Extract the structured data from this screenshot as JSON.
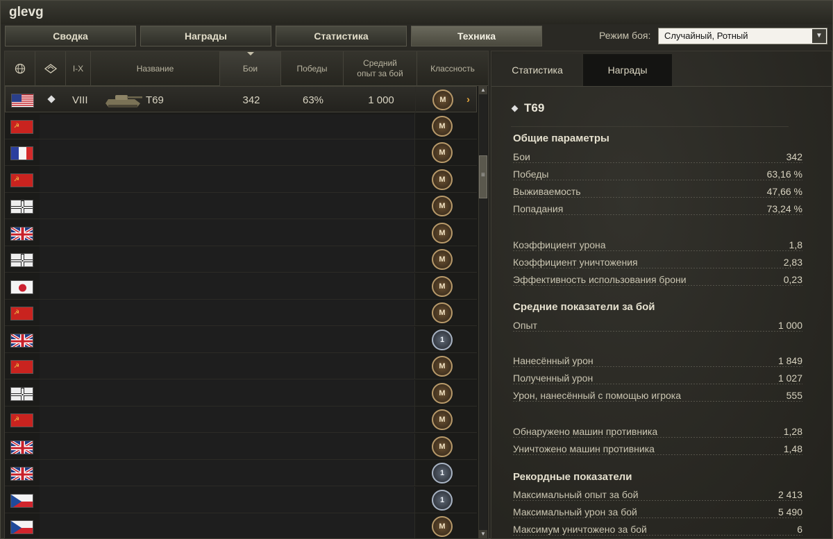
{
  "window": {
    "title": "glevg"
  },
  "tabs": [
    {
      "label": "Сводка",
      "active": false
    },
    {
      "label": "Награды",
      "active": false
    },
    {
      "label": "Статистика",
      "active": false
    },
    {
      "label": "Техника",
      "active": true
    }
  ],
  "battle_mode": {
    "label": "Режим боя:",
    "value": "Случайный, Ротный"
  },
  "table": {
    "headers": {
      "nation": "nation-globe-icon",
      "type": "vehicle-type-icon",
      "tier": "I-X",
      "name": "Название",
      "battles": "Бои",
      "wins": "Победы",
      "avg_xp": "Средний опыт за бой",
      "mastery": "Классность"
    },
    "sorted_column": "battles",
    "selected_row": {
      "nation": "usa",
      "tier": "VIII",
      "name": "T69",
      "battles": "342",
      "wins": "63%",
      "avg_xp": "1 000",
      "mastery": "M"
    },
    "rows": [
      {
        "nation": "usa",
        "mastery": "M"
      },
      {
        "nation": "ussr",
        "mastery": "M"
      },
      {
        "nation": "france",
        "mastery": "M"
      },
      {
        "nation": "ussr",
        "mastery": "M"
      },
      {
        "nation": "germany",
        "mastery": "M"
      },
      {
        "nation": "uk",
        "mastery": "M"
      },
      {
        "nation": "germany",
        "mastery": "M"
      },
      {
        "nation": "japan",
        "mastery": "M"
      },
      {
        "nation": "ussr",
        "mastery": "M"
      },
      {
        "nation": "uk",
        "mastery": "1"
      },
      {
        "nation": "ussr",
        "mastery": "M"
      },
      {
        "nation": "germany",
        "mastery": "M"
      },
      {
        "nation": "ussr",
        "mastery": "M"
      },
      {
        "nation": "uk",
        "mastery": "M"
      },
      {
        "nation": "uk",
        "mastery": "1"
      },
      {
        "nation": "czech",
        "mastery": "1"
      },
      {
        "nation": "czech",
        "mastery": "M"
      }
    ]
  },
  "details": {
    "tabs": [
      {
        "label": "Статистика",
        "active": true
      },
      {
        "label": "Награды",
        "active": false
      }
    ],
    "vehicle": "T69",
    "sections": {
      "general": "Общие параметры",
      "average": "Средние показатели за бой",
      "records": "Рекордные показатели"
    },
    "stats": {
      "battles": {
        "k": "Бои",
        "v": "342"
      },
      "wins": {
        "k": "Победы",
        "v": "63,16 %"
      },
      "survival": {
        "k": "Выживаемость",
        "v": "47,66 %"
      },
      "hits": {
        "k": "Попадания",
        "v": "73,24 %"
      },
      "dmg_ratio": {
        "k": "Коэффициент урона",
        "v": "1,8"
      },
      "kill_ratio": {
        "k": "Коэффициент уничтожения",
        "v": "2,83"
      },
      "armor_eff": {
        "k": "Эффективность использования брони",
        "v": "0,23"
      },
      "xp": {
        "k": "Опыт",
        "v": "1 000"
      },
      "dmg_dealt": {
        "k": "Нанесённый урон",
        "v": "1 849"
      },
      "dmg_recv": {
        "k": "Полученный урон",
        "v": "1 027"
      },
      "dmg_assist": {
        "k": "Урон, нанесённый с помощью игрока",
        "v": "555"
      },
      "spotted": {
        "k": "Обнаружено машин противника",
        "v": "1,28"
      },
      "destroyed": {
        "k": "Уничтожено машин противника",
        "v": "1,48"
      },
      "max_xp": {
        "k": "Максимальный опыт за бой",
        "v": "2 413"
      },
      "max_dmg": {
        "k": "Максимальный урон за бой",
        "v": "5 490"
      },
      "max_kills": {
        "k": "Максимум уничтожено за бой",
        "v": "6"
      }
    }
  }
}
